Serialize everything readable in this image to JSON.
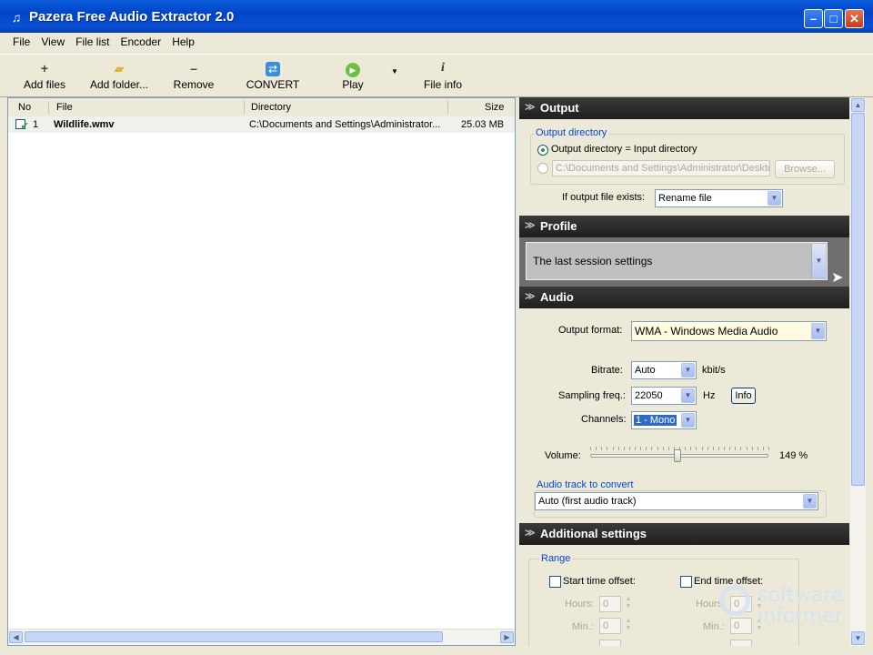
{
  "window": {
    "title": "Pazera Free Audio Extractor 2.0",
    "minimize": "–",
    "maximize": "□",
    "close": "✕"
  },
  "menu": [
    "File",
    "View",
    "File list",
    "Encoder",
    "Help"
  ],
  "toolbar": {
    "add_files": "Add files",
    "add_folder": "Add folder...",
    "remove": "Remove",
    "convert": "CONVERT",
    "play": "Play",
    "file_info": "File info"
  },
  "file_list": {
    "columns": [
      "No",
      "File",
      "Directory",
      "Size"
    ],
    "rows": [
      {
        "checked": true,
        "no": "1",
        "file": "Wildlife.wmv",
        "directory": "C:\\Documents and Settings\\Administrator...",
        "size": "25.03 MB"
      }
    ]
  },
  "output": {
    "header": "Output",
    "group_label": "Output directory",
    "radio_input_dir": "Output directory = Input directory",
    "custom_dir_value": "C:\\Documents and Settings\\Administrator\\Deskto",
    "browse": "Browse...",
    "if_exists_label": "If output file exists:",
    "if_exists_value": "Rename file"
  },
  "profile": {
    "header": "Profile",
    "value": "The last session settings"
  },
  "audio": {
    "header": "Audio",
    "output_format_label": "Output format:",
    "output_format_value": "WMA - Windows Media Audio",
    "bitrate_label": "Bitrate:",
    "bitrate_value": "Auto",
    "bitrate_unit": "kbit/s",
    "sampling_label": "Sampling freq.:",
    "sampling_value": "22050",
    "sampling_unit": "Hz",
    "info_button": "Info",
    "channels_label": "Channels:",
    "channels_value": "1 - Mono",
    "volume_label": "Volume:",
    "volume_value": "149 %",
    "volume_level": 0.49,
    "track_group_label": "Audio track to convert",
    "track_value": "Auto (first audio track)"
  },
  "additional": {
    "header": "Additional settings",
    "range_label": "Range",
    "start_offset": "Start time offset:",
    "end_offset": "End time offset:",
    "hours_label": "Hours:",
    "min_label": "Min.:",
    "zero": "0"
  },
  "watermark": {
    "line1": "software",
    "line2": "informer"
  }
}
